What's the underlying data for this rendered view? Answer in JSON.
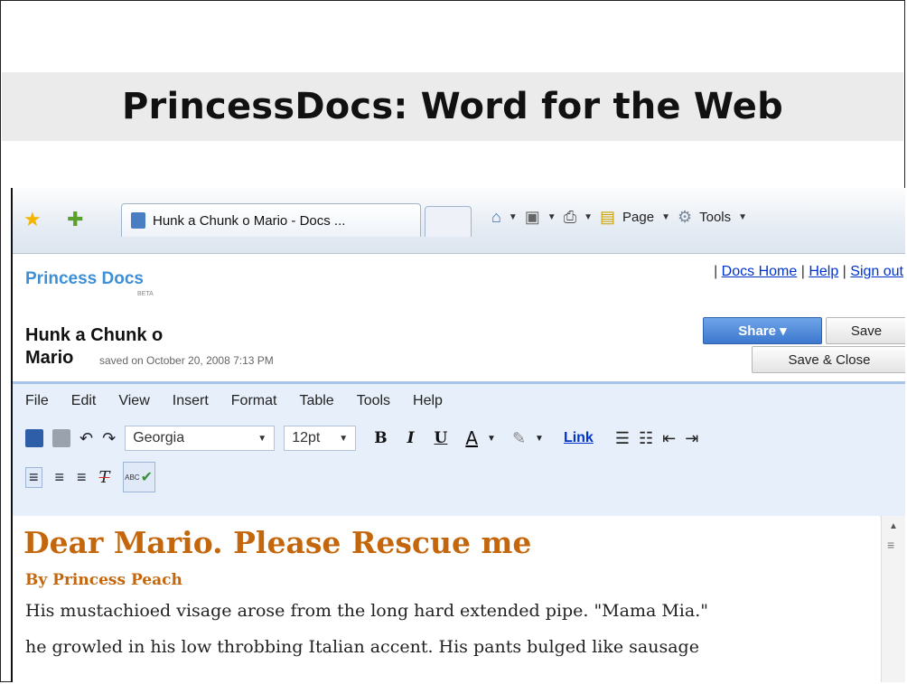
{
  "slide": {
    "title": "PrincessDocs: Word for the Web"
  },
  "browser": {
    "tab_title": "Hunk a Chunk o Mario - Docs ...",
    "page_label": "Page",
    "tools_label": "Tools"
  },
  "docs": {
    "logo_text": "Princess Docs",
    "logo_beta": "BETA",
    "links": {
      "docs_home": "Docs Home",
      "help": "Help",
      "sign_out": "Sign out",
      "sep": "|"
    },
    "doc_title_line1": "Hunk a Chunk o",
    "doc_title_line2": "Mario",
    "saved_text": "saved on October 20, 2008 7:13 PM",
    "share_label": "Share ▾",
    "save_label": "Save",
    "save_close_label": "Save & Close"
  },
  "editor": {
    "menu": [
      "File",
      "Edit",
      "View",
      "Insert",
      "Format",
      "Table",
      "Tools",
      "Help"
    ],
    "font_family": "Georgia",
    "font_size": "12pt",
    "bold": "B",
    "italic": "I",
    "underline": "U",
    "text_color": "A",
    "link_label": "Link",
    "spell_label": "ABC"
  },
  "document": {
    "heading": "Dear Mario.  Please Rescue me",
    "byline": "By Princess Peach",
    "line1": "His mustachioed visage arose from the long hard extended pipe.  \"Mama Mia.\"",
    "line2": "he growled in his low throbbing Italian accent.   His pants bulged like sausage"
  },
  "colors": {
    "heading_orange": "#c4670c",
    "logo_blue": "#3d8fd6",
    "share_blue": "#3d78cf",
    "link_blue": "#0033cc"
  }
}
